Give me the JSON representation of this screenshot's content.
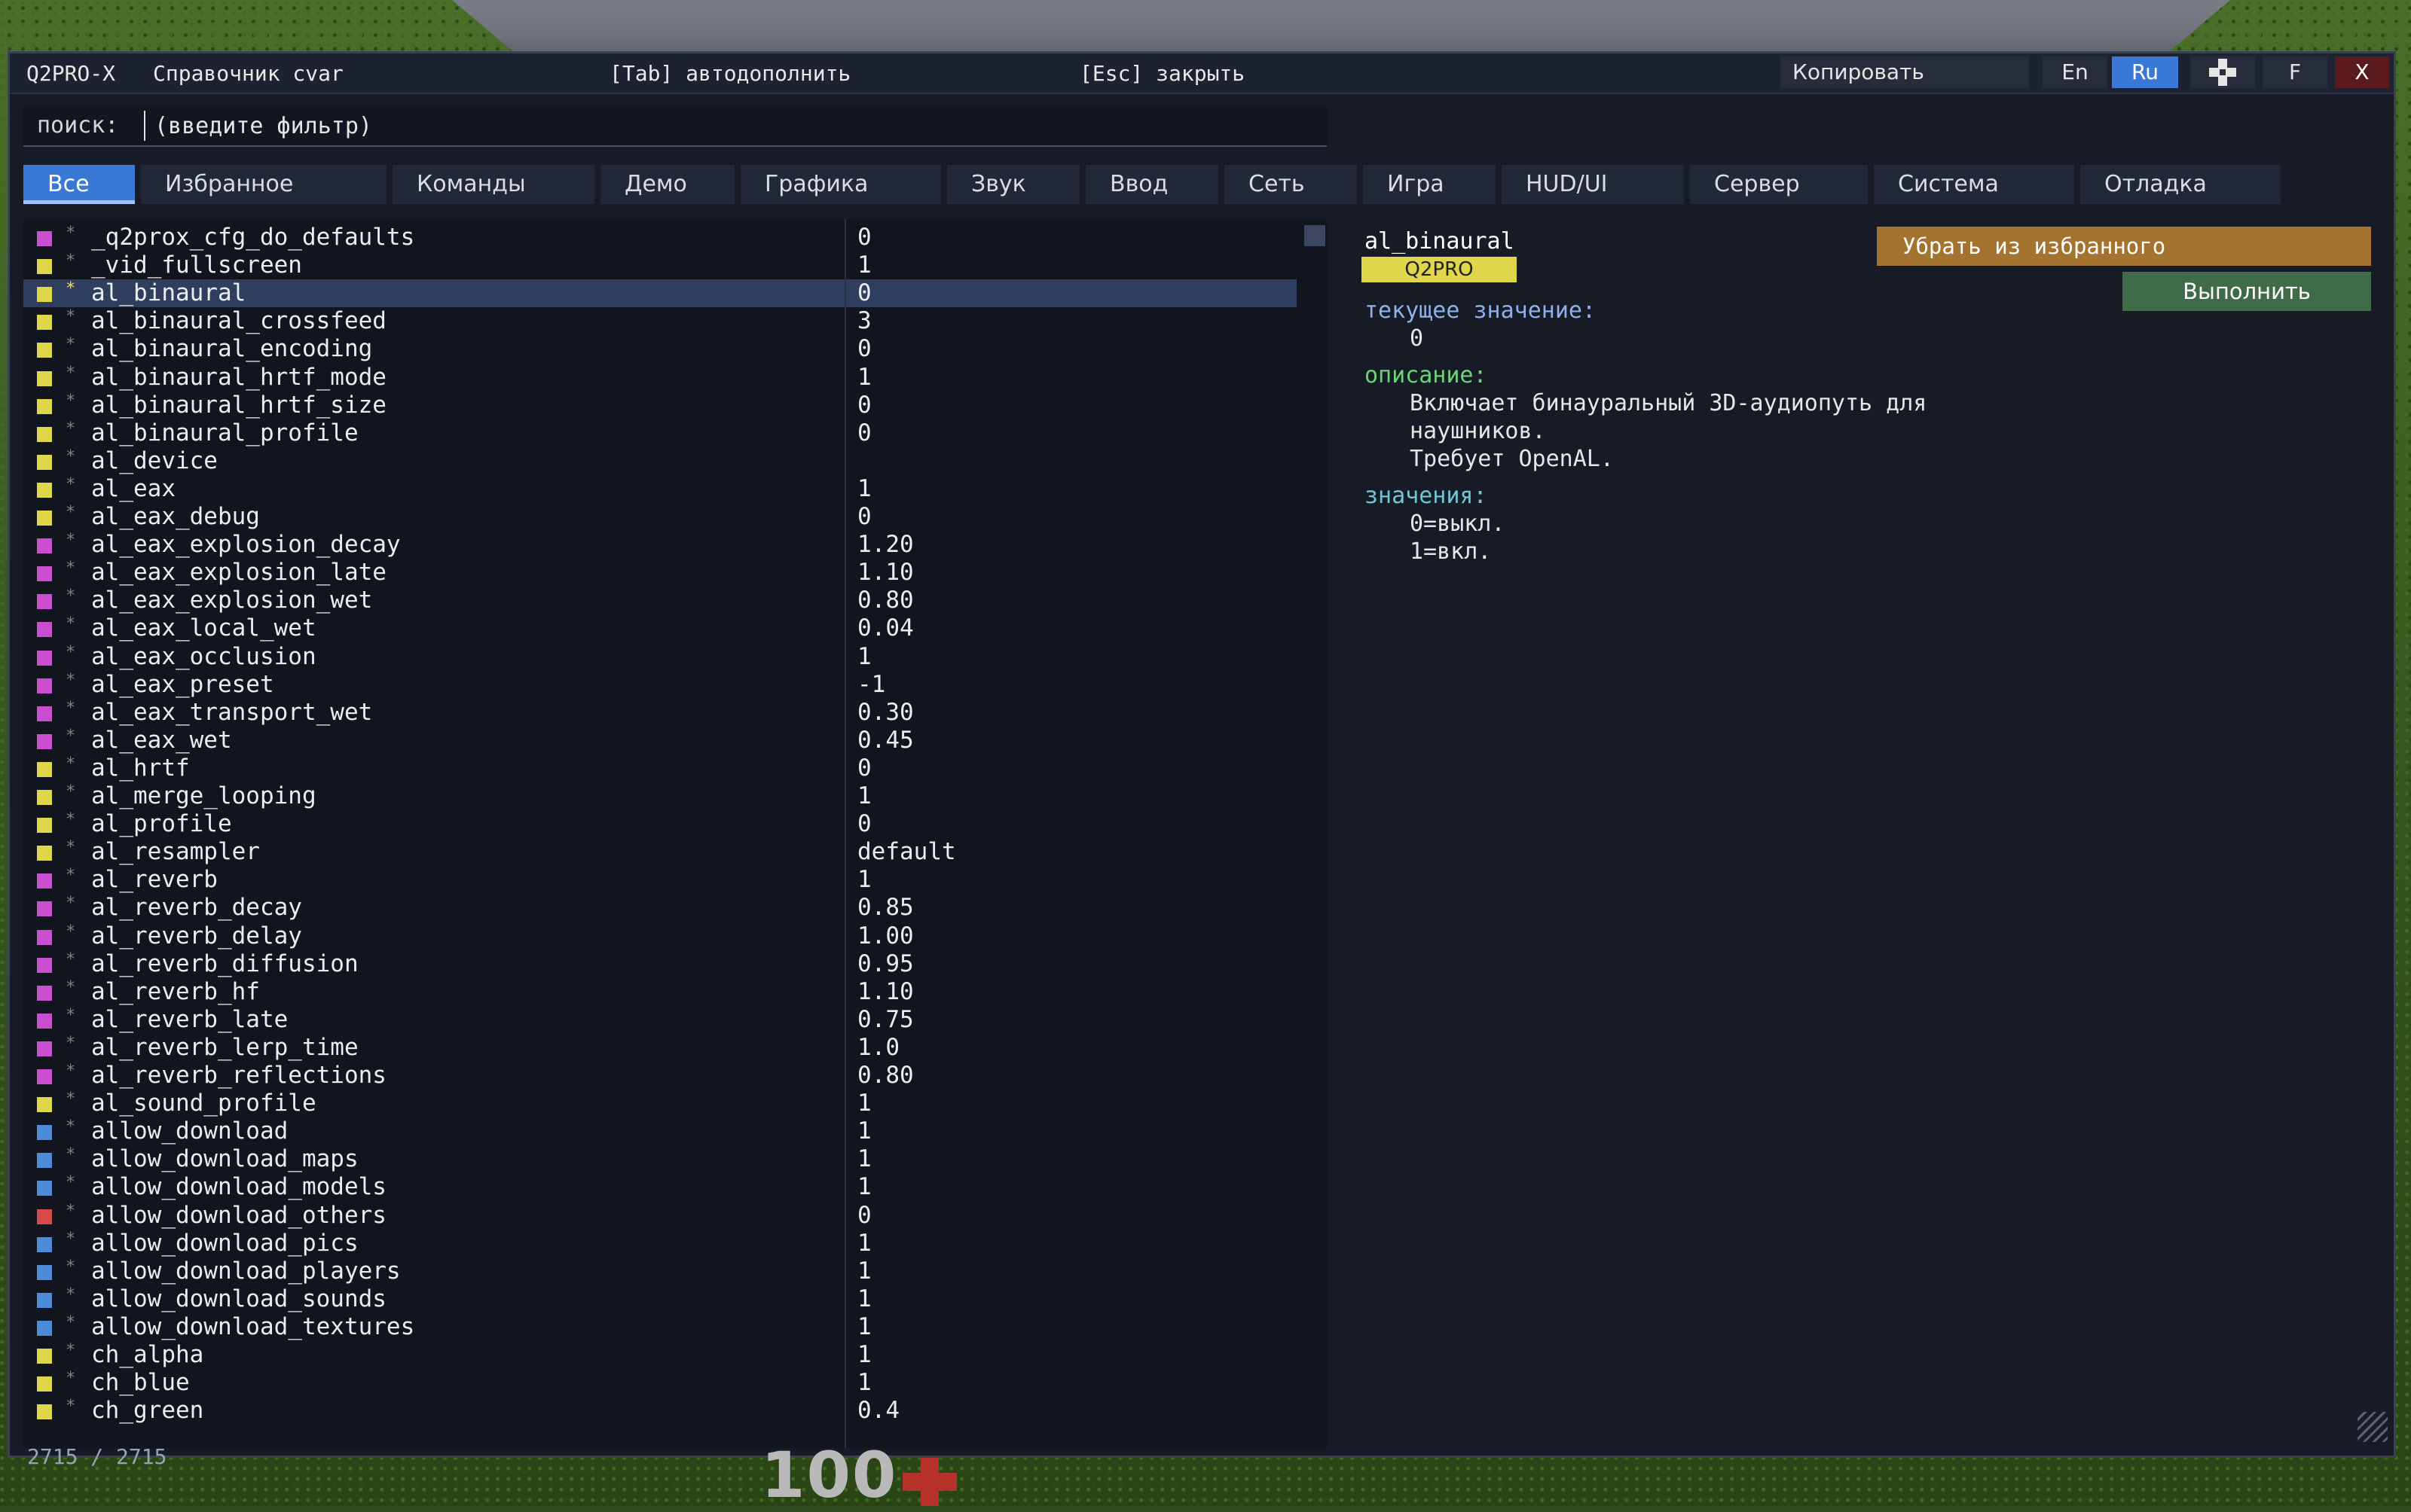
{
  "titlebar": {
    "app": "Q2PRO-X",
    "title": "Справочник cvar",
    "tab_hint": "[Tab] автодополнить",
    "esc_hint": "[Esc] закрыть",
    "copy_label": "Копировать",
    "lang_en": "En",
    "lang_ru": "Ru",
    "f_label": "F",
    "close_label": "X"
  },
  "search": {
    "label": "поиск:",
    "placeholder": "(введите фильтр)",
    "value": ""
  },
  "tabs": [
    "Все",
    "Избранное",
    "Команды",
    "Демо",
    "Графика",
    "Звук",
    "Ввод",
    "Сеть",
    "Игра",
    "HUD/UI",
    "Сервер",
    "Система",
    "Отладка"
  ],
  "active_tab": "Все",
  "colors": {
    "magenta": "#c94fcf",
    "yellow": "#e0d64a",
    "blue": "#4d8ad8",
    "red": "#d84a4a",
    "accent": "#3a78d6"
  },
  "rows": [
    {
      "name": "_q2prox_cfg_do_defaults",
      "value": "0",
      "color": "#c94fcf",
      "fav": false
    },
    {
      "name": "_vid_fullscreen",
      "value": "1",
      "color": "#e0d64a",
      "fav": false
    },
    {
      "name": "al_binaural",
      "value": "0",
      "color": "#e0d64a",
      "fav": true,
      "selected": true
    },
    {
      "name": "al_binaural_crossfeed",
      "value": "3",
      "color": "#e0d64a",
      "fav": false
    },
    {
      "name": "al_binaural_encoding",
      "value": "0",
      "color": "#e0d64a",
      "fav": false
    },
    {
      "name": "al_binaural_hrtf_mode",
      "value": "1",
      "color": "#e0d64a",
      "fav": false
    },
    {
      "name": "al_binaural_hrtf_size",
      "value": "0",
      "color": "#e0d64a",
      "fav": false
    },
    {
      "name": "al_binaural_profile",
      "value": "0",
      "color": "#e0d64a",
      "fav": false
    },
    {
      "name": "al_device",
      "value": "",
      "color": "#e0d64a",
      "fav": false
    },
    {
      "name": "al_eax",
      "value": "1",
      "color": "#e0d64a",
      "fav": false
    },
    {
      "name": "al_eax_debug",
      "value": "0",
      "color": "#e0d64a",
      "fav": false
    },
    {
      "name": "al_eax_explosion_decay",
      "value": "1.20",
      "color": "#c94fcf",
      "fav": false
    },
    {
      "name": "al_eax_explosion_late",
      "value": "1.10",
      "color": "#c94fcf",
      "fav": false
    },
    {
      "name": "al_eax_explosion_wet",
      "value": "0.80",
      "color": "#c94fcf",
      "fav": false
    },
    {
      "name": "al_eax_local_wet",
      "value": "0.04",
      "color": "#c94fcf",
      "fav": false
    },
    {
      "name": "al_eax_occlusion",
      "value": "1",
      "color": "#c94fcf",
      "fav": false
    },
    {
      "name": "al_eax_preset",
      "value": "-1",
      "color": "#c94fcf",
      "fav": false
    },
    {
      "name": "al_eax_transport_wet",
      "value": "0.30",
      "color": "#c94fcf",
      "fav": false
    },
    {
      "name": "al_eax_wet",
      "value": "0.45",
      "color": "#c94fcf",
      "fav": false
    },
    {
      "name": "al_hrtf",
      "value": "0",
      "color": "#e0d64a",
      "fav": false
    },
    {
      "name": "al_merge_looping",
      "value": "1",
      "color": "#e0d64a",
      "fav": false
    },
    {
      "name": "al_profile",
      "value": "0",
      "color": "#e0d64a",
      "fav": false
    },
    {
      "name": "al_resampler",
      "value": "default",
      "color": "#e0d64a",
      "fav": false
    },
    {
      "name": "al_reverb",
      "value": "1",
      "color": "#c94fcf",
      "fav": false
    },
    {
      "name": "al_reverb_decay",
      "value": "0.85",
      "color": "#c94fcf",
      "fav": false
    },
    {
      "name": "al_reverb_delay",
      "value": "1.00",
      "color": "#c94fcf",
      "fav": false
    },
    {
      "name": "al_reverb_diffusion",
      "value": "0.95",
      "color": "#c94fcf",
      "fav": false
    },
    {
      "name": "al_reverb_hf",
      "value": "1.10",
      "color": "#c94fcf",
      "fav": false
    },
    {
      "name": "al_reverb_late",
      "value": "0.75",
      "color": "#c94fcf",
      "fav": false
    },
    {
      "name": "al_reverb_lerp_time",
      "value": "1.0",
      "color": "#c94fcf",
      "fav": false
    },
    {
      "name": "al_reverb_reflections",
      "value": "0.80",
      "color": "#c94fcf",
      "fav": false
    },
    {
      "name": "al_sound_profile",
      "value": "1",
      "color": "#e0d64a",
      "fav": false
    },
    {
      "name": "allow_download",
      "value": "1",
      "color": "#4d8ad8",
      "fav": false
    },
    {
      "name": "allow_download_maps",
      "value": "1",
      "color": "#4d8ad8",
      "fav": false
    },
    {
      "name": "allow_download_models",
      "value": "1",
      "color": "#4d8ad8",
      "fav": false
    },
    {
      "name": "allow_download_others",
      "value": "0",
      "color": "#d84a4a",
      "fav": false
    },
    {
      "name": "allow_download_pics",
      "value": "1",
      "color": "#4d8ad8",
      "fav": false
    },
    {
      "name": "allow_download_players",
      "value": "1",
      "color": "#4d8ad8",
      "fav": false
    },
    {
      "name": "allow_download_sounds",
      "value": "1",
      "color": "#4d8ad8",
      "fav": false
    },
    {
      "name": "allow_download_textures",
      "value": "1",
      "color": "#4d8ad8",
      "fav": false
    },
    {
      "name": "ch_alpha",
      "value": "1",
      "color": "#e0d64a",
      "fav": false
    },
    {
      "name": "ch_blue",
      "value": "1",
      "color": "#e0d64a",
      "fav": false
    },
    {
      "name": "ch_green",
      "value": "0.4",
      "color": "#e0d64a",
      "fav": false
    }
  ],
  "detail": {
    "name": "al_binaural",
    "badge": "Q2PRO",
    "unfav_label": "Убрать из избранного",
    "run_label": "Выполнить",
    "current_header": "текущее значение:",
    "current_value": "0",
    "desc_header": "описание:",
    "desc_lines": [
      "Включает бинауральный 3D-аудиопуть для",
      "наушников.",
      "Требует OpenAL."
    ],
    "values_header": "значения:",
    "values_lines": [
      "0=выкл.",
      "1=вкл."
    ]
  },
  "status": {
    "count": "2715 / 2715"
  },
  "hud": {
    "health": "100"
  }
}
